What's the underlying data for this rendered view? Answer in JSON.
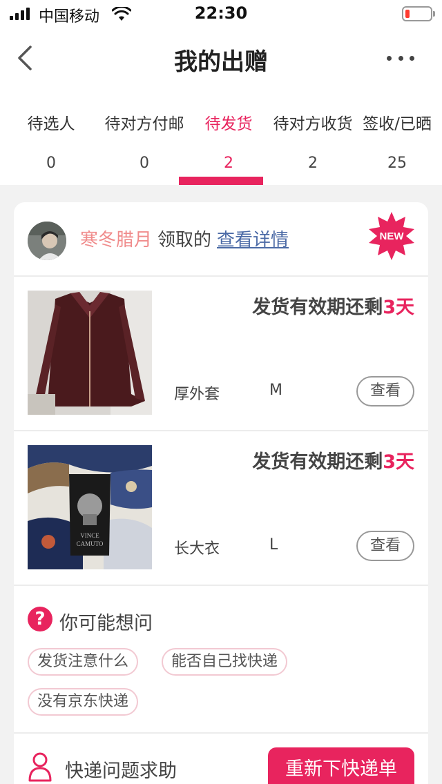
{
  "status_bar": {
    "carrier": "中国移动",
    "time": "22:30",
    "battery_color": "#ff3b30"
  },
  "nav": {
    "title": "我的出赠",
    "back_icon": "chevron-left-icon",
    "more_icon": "more-horizontal-icon"
  },
  "tabs": [
    {
      "label": "待选人",
      "count": "0",
      "active": false
    },
    {
      "label": "待对方付邮",
      "count": "0",
      "active": false
    },
    {
      "label": "待发货",
      "count": "2",
      "active": true
    },
    {
      "label": "待对方收货",
      "count": "2",
      "active": false
    },
    {
      "label": "签收/已晒",
      "count": "25",
      "active": false
    }
  ],
  "claim": {
    "claimer": "寒冬腊月",
    "verb": "领取的",
    "link": "查看详情",
    "badge": "NEW"
  },
  "items": [
    {
      "deadline_prefix": "发货有效期还剩",
      "deadline_days": "3天",
      "name": "厚外套",
      "size": "M",
      "view_label": "查看"
    },
    {
      "deadline_prefix": "发货有效期还剩",
      "deadline_days": "3天",
      "name": "长大衣",
      "size": "L",
      "view_label": "查看"
    }
  ],
  "faq": {
    "icon_text": "?",
    "title": "你可能想问",
    "chips": [
      "发货注意什么",
      "能否自己找快递",
      "没有京东快递"
    ]
  },
  "help": {
    "title": "快递问题求助",
    "button": "重新下快递单"
  },
  "colors": {
    "accent": "#e8245e",
    "claimer": "#f08c8c",
    "link": "#4b6aa6"
  }
}
